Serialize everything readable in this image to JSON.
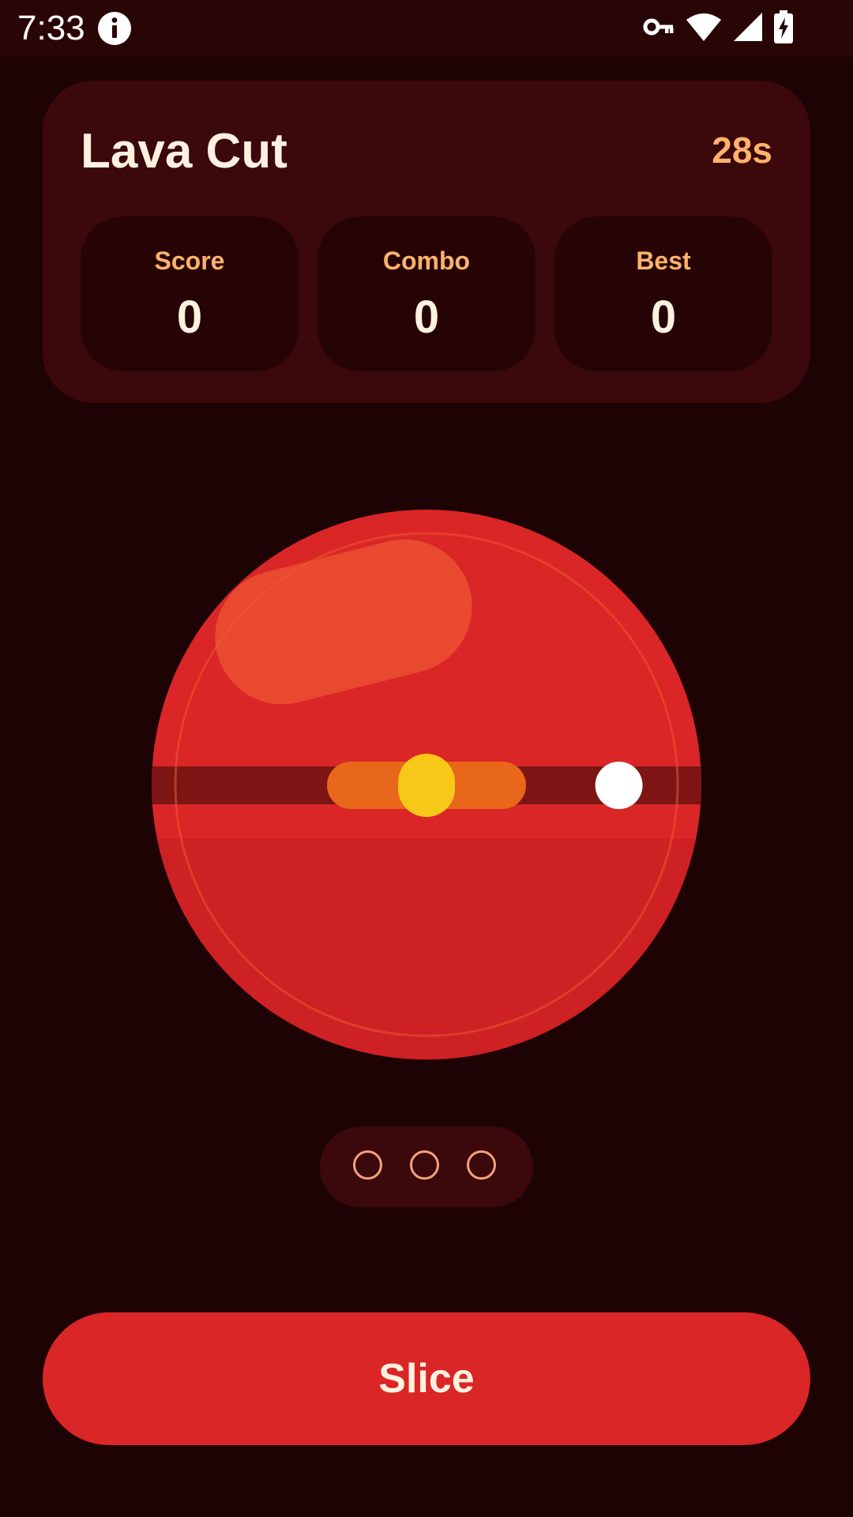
{
  "status_bar": {
    "time": "7:33",
    "icons": [
      "info-icon",
      "vpn-key-icon",
      "wifi-icon",
      "signal-icon",
      "battery-charging-icon"
    ]
  },
  "header": {
    "title": "Lava Cut",
    "timer": "28s"
  },
  "stats": {
    "score": {
      "label": "Score",
      "value": "0"
    },
    "combo": {
      "label": "Combo",
      "value": "0"
    },
    "best": {
      "label": "Best",
      "value": "0"
    }
  },
  "game": {
    "target_zone_center": 0.5,
    "cursor_position": 0.85,
    "ball_color": "#da2626",
    "track_color": "#7d1515",
    "target_zone_color": "#e8671a",
    "target_marker_color": "#f8c818",
    "cursor_color": "#ffffff"
  },
  "lives": {
    "total": 3,
    "filled": 0
  },
  "action": {
    "slice_label": "Slice"
  },
  "colors": {
    "background": "#1e0304",
    "card": "#3b090b",
    "accent": "#ffb26b",
    "primary": "#da2626"
  }
}
